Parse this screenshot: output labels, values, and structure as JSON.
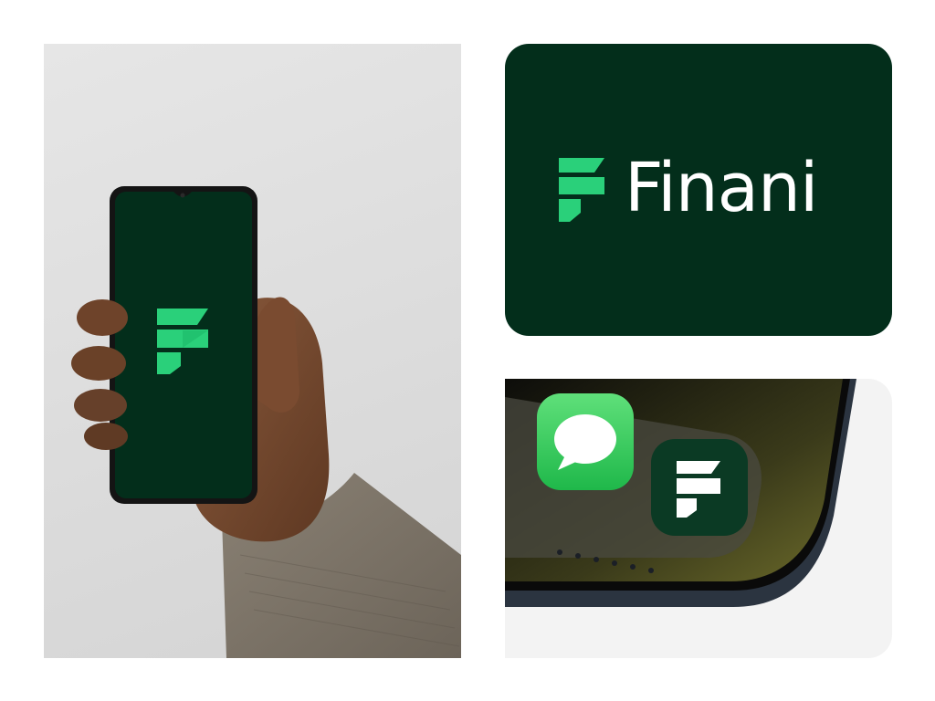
{
  "brand": {
    "name": "Finani",
    "colors": {
      "primary_dark": "#032e1b",
      "accent_green": "#2ad07a",
      "accent_green_dark": "#12a85c",
      "white": "#ffffff"
    }
  },
  "left_panel": {
    "icons": [
      "finani-logo-icon"
    ]
  },
  "brand_card": {
    "wordmark": "Finani",
    "icons": [
      "finani-logo-icon"
    ]
  },
  "icon_panel": {
    "apps": [
      {
        "icon": "messages-app-icon",
        "color": "#34c759"
      },
      {
        "icon": "finani-app-icon",
        "color": "#0b3a24"
      }
    ]
  }
}
